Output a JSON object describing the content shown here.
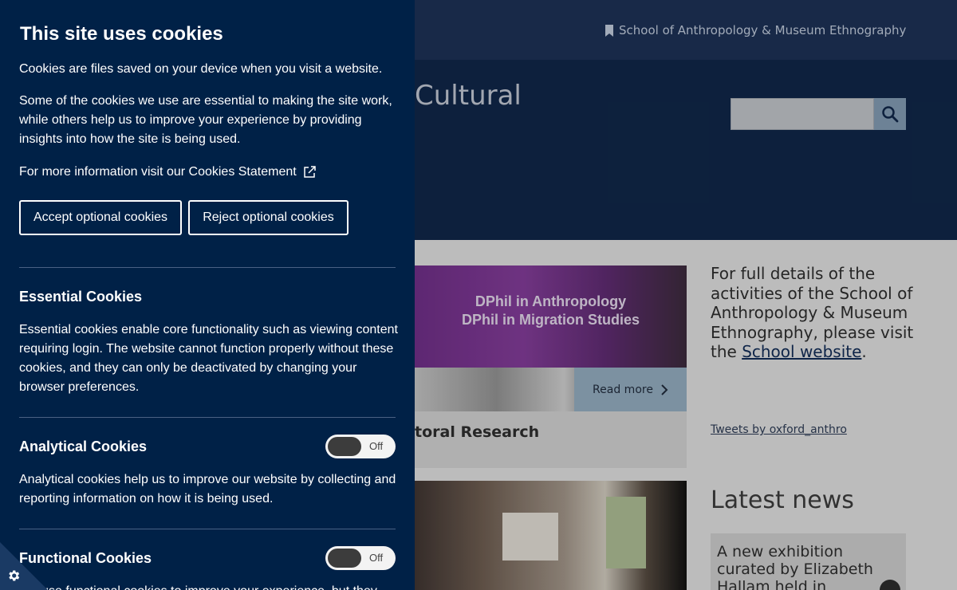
{
  "site": {
    "school_link": "School of Anthropology & Museum Ethnography",
    "title_fragment": "Cultural",
    "search": {
      "placeholder": ""
    },
    "card1": {
      "banner_line1": "DPhil in Anthropology",
      "banner_line2": "DPhil in Migration Studies",
      "read_more": "Read more",
      "title_fragment": "toral Research"
    },
    "sidebar": {
      "text_before_link": "For full details of the activities of the School of Anthropology & Museum Ethnography, please visit the ",
      "link_text": "School website",
      "text_after_link": "."
    },
    "tweets_link": "Tweets by oxford_anthro",
    "latest_news_heading": "Latest news",
    "news_item": "A new exhibition curated by Elizabeth Hallam held in"
  },
  "cookie_banner": {
    "title": "This site uses cookies",
    "intro": "Cookies are files saved on your device when you visit a website.",
    "detail": "Some of the cookies we use are essential to making the site work, while others help us to improve your experience by providing insights into how the site is being used.",
    "more_info": "For more information visit our Cookies Statement",
    "accept_button": "Accept optional cookies",
    "reject_button": "Reject optional cookies",
    "sections": [
      {
        "heading": "Essential Cookies",
        "description": "Essential cookies enable core functionality such as viewing content requiring login. The website cannot function properly without these cookies, and they can only be deactivated by changing your browser preferences."
      },
      {
        "heading": "Analytical Cookies",
        "toggle_state": "Off",
        "description": "Analytical cookies help us to improve our website by collecting and reporting information on how it is being used."
      },
      {
        "heading": "Functional Cookies",
        "toggle_state": "Off",
        "description": "We use functional cookies to improve your experience, but they"
      }
    ]
  },
  "colors": {
    "panel_bg": "#002147",
    "header_bg": "#0f2546",
    "topbar_bg": "#1c2f52"
  },
  "icons": [
    "bookmark-icon",
    "search-icon",
    "external-link-icon",
    "chevron-right-icon",
    "gear-icon"
  ]
}
